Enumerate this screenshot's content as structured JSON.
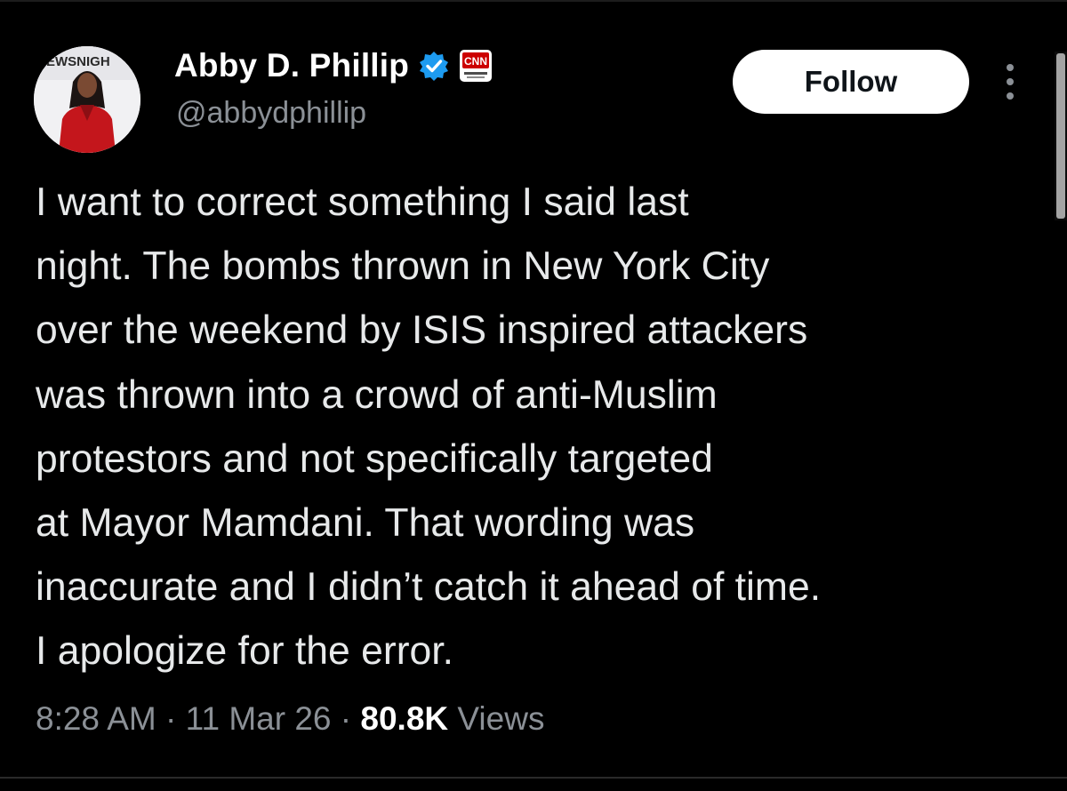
{
  "author": {
    "display_name": "Abby D. Phillip",
    "handle": "@abbydphillip",
    "avatar_backdrop_text": "EWSNIGH",
    "affiliate_badge_text": "CNN",
    "verified_color": "#1d9bf0",
    "affiliate_color": "#cc0000"
  },
  "actions": {
    "follow_label": "Follow",
    "more_icon": "more-vertical-icon"
  },
  "tweet": {
    "lines": [
      "I want to correct something I said last",
      "night. The bombs thrown in New York City",
      "over the weekend by ISIS inspired attackers",
      "was thrown into a crowd of anti-Muslim",
      "protestors and not specifically targeted",
      "at Mayor Mamdani. That wording was",
      "inaccurate and I didn’t catch it ahead of time.",
      "I apologize for the error."
    ]
  },
  "meta": {
    "time": "8:28 AM",
    "separator": "·",
    "date": "11 Mar 26",
    "views_count": "80.8K",
    "views_label": "Views"
  }
}
